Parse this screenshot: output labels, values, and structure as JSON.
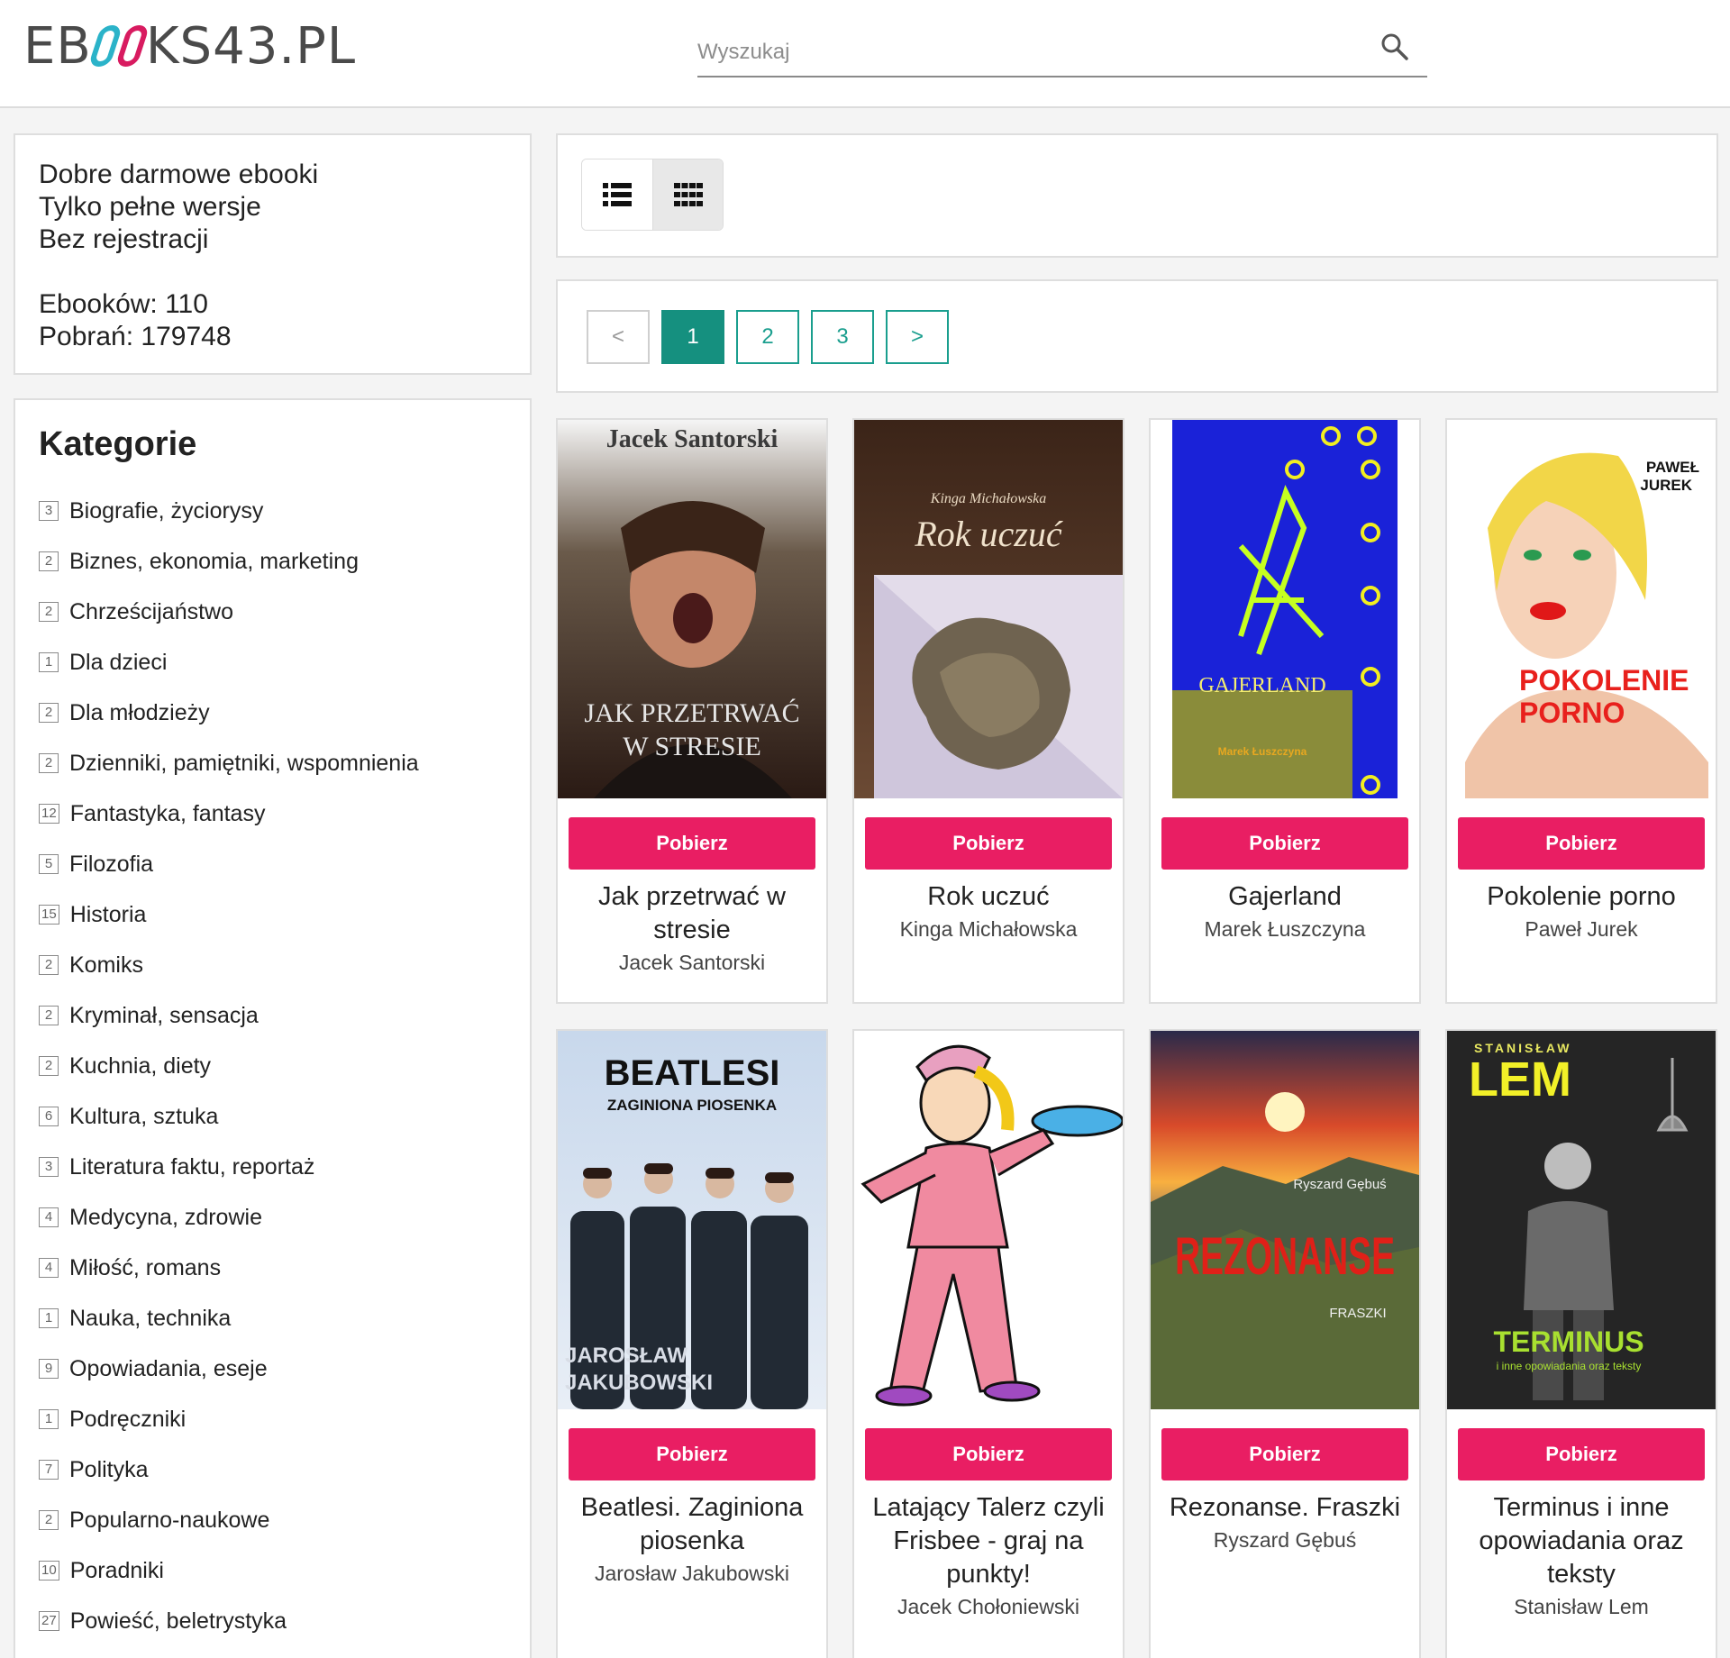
{
  "header": {
    "logo": {
      "part1": "EB",
      "part2": "KS43.PL"
    },
    "search_placeholder": "Wyszukaj"
  },
  "info": {
    "line1": "Dobre darmowe ebooki",
    "line2": "Tylko pełne wersje",
    "line3": "Bez rejestracji",
    "ebooks": "Ebooków: 110",
    "downloads": "Pobrań: 179748"
  },
  "categories": {
    "title": "Kategorie",
    "items": [
      {
        "count": "3",
        "label": "Biografie, życiorysy"
      },
      {
        "count": "2",
        "label": "Biznes, ekonomia, marketing"
      },
      {
        "count": "2",
        "label": "Chrześcijaństwo"
      },
      {
        "count": "1",
        "label": "Dla dzieci"
      },
      {
        "count": "2",
        "label": "Dla młodzieży"
      },
      {
        "count": "2",
        "label": "Dzienniki, pamiętniki, wspomnienia"
      },
      {
        "count": "12",
        "label": "Fantastyka, fantasy"
      },
      {
        "count": "5",
        "label": "Filozofia"
      },
      {
        "count": "15",
        "label": "Historia"
      },
      {
        "count": "2",
        "label": "Komiks"
      },
      {
        "count": "2",
        "label": "Kryminał, sensacja"
      },
      {
        "count": "2",
        "label": "Kuchnia, diety"
      },
      {
        "count": "6",
        "label": "Kultura, sztuka"
      },
      {
        "count": "3",
        "label": "Literatura faktu, reportaż"
      },
      {
        "count": "4",
        "label": "Medycyna, zdrowie"
      },
      {
        "count": "4",
        "label": "Miłość, romans"
      },
      {
        "count": "1",
        "label": "Nauka, technika"
      },
      {
        "count": "9",
        "label": "Opowiadania, eseje"
      },
      {
        "count": "1",
        "label": "Podręczniki"
      },
      {
        "count": "7",
        "label": "Polityka"
      },
      {
        "count": "2",
        "label": "Popularno-naukowe"
      },
      {
        "count": "10",
        "label": "Poradniki"
      },
      {
        "count": "27",
        "label": "Powieść, beletrystyka"
      }
    ]
  },
  "pagination": {
    "prev": "<",
    "pages": [
      "1",
      "2",
      "3"
    ],
    "next": ">",
    "current": "1"
  },
  "download_label": "Pobierz",
  "books": [
    {
      "title": "Jak przetrwać w stresie",
      "author": "Jacek Santorski",
      "cover": {
        "top": "Jacek Santorski",
        "line1": "JAK PRZETRWAĆ",
        "line2": "W STRESIE"
      }
    },
    {
      "title": "Rok uczuć",
      "author": "Kinga Michałowska",
      "cover": {
        "small": "Kinga Michałowska",
        "big": "Rok uczuć"
      }
    },
    {
      "title": "Gajerland",
      "author": "Marek Łuszczyna",
      "cover": {
        "big": "GAJERLAND",
        "small": "Marek Łuszczyna"
      }
    },
    {
      "title": "Pokolenie porno",
      "author": "Paweł Jurek",
      "cover": {
        "a1": "PAWEŁ",
        "a2": "JUREK",
        "t1": "POKOLENIE",
        "t2": "PORNO"
      }
    },
    {
      "title": "Beatlesi. Zaginiona piosenka",
      "author": "Jarosław Jakubowski",
      "cover": {
        "big": "BEATLESI",
        "sub": "ZAGINIONA PIOSENKA",
        "a1": "JAROSŁAW",
        "a2": "JAKUBOWSKI"
      }
    },
    {
      "title": "Latający Talerz czyli Frisbee - graj na punkty!",
      "author": "Jacek Chołoniewski",
      "cover": {}
    },
    {
      "title": "Rezonanse. Fraszki",
      "author": "Ryszard Gębuś",
      "cover": {
        "author": "Ryszard Gębuś",
        "big": "REZONANSE",
        "sub": "FRASZKI"
      }
    },
    {
      "title": "Terminus i inne opowiadania oraz teksty",
      "author": "Stanisław Lem",
      "cover": {
        "small": "STANISŁAW",
        "big": "LEM",
        "t1": "TERMINUS",
        "t2": "i inne opowiadania oraz teksty"
      }
    }
  ]
}
